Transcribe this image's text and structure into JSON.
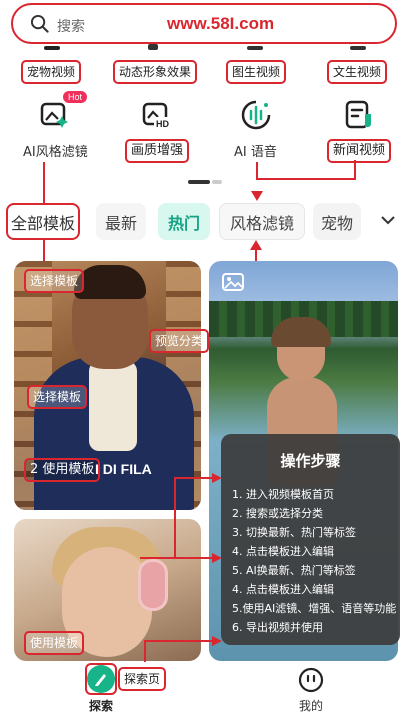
{
  "search": {
    "placeholder": "搜索",
    "brand_text": "www.58I.com"
  },
  "feature_row1": [
    "宠物视频",
    "动态形象效果",
    "图生视频",
    "文生视频"
  ],
  "feature_row2": [
    {
      "label": "AI风格滤镜",
      "badge": "Hot",
      "icon": "ai-filter-icon"
    },
    {
      "label": "画质增强",
      "icon": "hd-enhance-icon"
    },
    {
      "label": "AI 语音",
      "icon": "ai-voice-icon"
    },
    {
      "label": "新闻视频",
      "icon": "news-video-icon"
    }
  ],
  "tabs": [
    "全部模板",
    "最新",
    "热门",
    "风格滤镜",
    "宠物"
  ],
  "active_tab": "热门",
  "annotations": {
    "select_template_1": "选择模板",
    "select_template_2": "选择模板",
    "preview_category": "预览分类",
    "use_template_2": "2 使用模板",
    "use_template": "使用模板",
    "explore_page": "探索页"
  },
  "cards": [
    {
      "title_suffix": "I DI FILA"
    }
  ],
  "steps": {
    "title": "操作步骤",
    "items": [
      "1. 进入视频模板首页",
      "2. 搜索或选择分类",
      "3. 切换最新、热门等标签",
      "4. 点击模板进入编辑",
      "5. AI换最新、热门等标签",
      "4. 点击模板进入编辑",
      "5.使用AI滤镜、增强、语音等功能",
      "6. 导出视频并使用"
    ]
  },
  "nav": {
    "explore": "探索",
    "me": "我的"
  },
  "colors": {
    "accent_red": "#d9262f",
    "brand_green": "#17b48a",
    "hot_tab_bg": "#d8f7ee",
    "hot_tab_text": "#16a385"
  }
}
